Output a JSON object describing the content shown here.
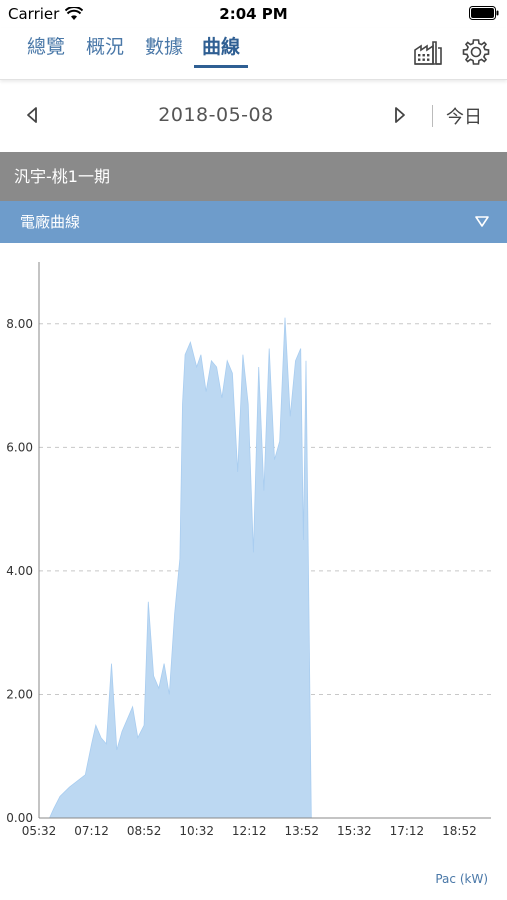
{
  "status_bar": {
    "carrier": "Carrier",
    "time": "2:04 PM"
  },
  "tabs": [
    {
      "label": "總覽",
      "active": false
    },
    {
      "label": "概況",
      "active": false
    },
    {
      "label": "數據",
      "active": false
    },
    {
      "label": "曲線",
      "active": true
    }
  ],
  "icons": {
    "factory": "factory-icon",
    "settings": "gear-icon"
  },
  "date_nav": {
    "date": "2018-05-08",
    "today_label": "今日"
  },
  "site": {
    "name": "汎宇-桃1一期"
  },
  "curve_selector": {
    "label": "電廠曲線"
  },
  "colors": {
    "accent": "#2f5f93",
    "tab": "#4a78a8",
    "site_bar": "#8a8a8a",
    "curve_bar": "#6e9ccb",
    "fill": "#bcd8f2"
  },
  "chart_data": {
    "type": "area",
    "ylim": [
      0,
      9
    ],
    "xlim": [
      "05:32",
      "19:52"
    ],
    "yticks": [
      "0.00",
      "2.00",
      "4.00",
      "6.00",
      "8.00"
    ],
    "ytick_values": [
      0,
      2,
      4,
      6,
      8
    ],
    "xticks": [
      "05:32",
      "07:12",
      "08:52",
      "10:32",
      "12:12",
      "13:52",
      "15:32",
      "17:12",
      "18:52"
    ],
    "grid": true,
    "unit_label": "Pac (kW)",
    "series": [
      {
        "x": [
          "05:32",
          "05:52",
          "06:00",
          "06:12",
          "06:30",
          "06:45",
          "07:00",
          "07:12",
          "07:20",
          "07:30",
          "07:40",
          "07:50",
          "08:00",
          "08:10",
          "08:20",
          "08:30",
          "08:40",
          "08:52",
          "09:00",
          "09:10",
          "09:20",
          "09:30",
          "09:40",
          "09:50",
          "10:00",
          "10:05",
          "10:10",
          "10:20",
          "10:32",
          "10:40",
          "10:50",
          "11:00",
          "11:10",
          "11:20",
          "11:30",
          "11:40",
          "11:50",
          "12:00",
          "12:10",
          "12:20",
          "12:30",
          "12:40",
          "12:50",
          "13:00",
          "13:10",
          "13:20",
          "13:30",
          "13:40",
          "13:50",
          "13:55",
          "14:00",
          "14:05",
          "14:10"
        ],
        "values": [
          0,
          0,
          0.15,
          0.35,
          0.5,
          0.6,
          0.7,
          1.2,
          1.5,
          1.3,
          1.2,
          2.5,
          1.1,
          1.4,
          1.6,
          1.8,
          1.3,
          1.5,
          3.5,
          2.3,
          2.1,
          2.5,
          2.0,
          3.3,
          4.2,
          6.7,
          7.5,
          7.7,
          7.3,
          7.5,
          6.9,
          7.4,
          7.3,
          6.8,
          7.4,
          7.2,
          5.6,
          7.5,
          6.7,
          4.3,
          7.3,
          5.3,
          7.6,
          5.8,
          6.1,
          8.1,
          6.5,
          7.4,
          7.6,
          4.5,
          7.4,
          3.8,
          0
        ]
      }
    ]
  }
}
